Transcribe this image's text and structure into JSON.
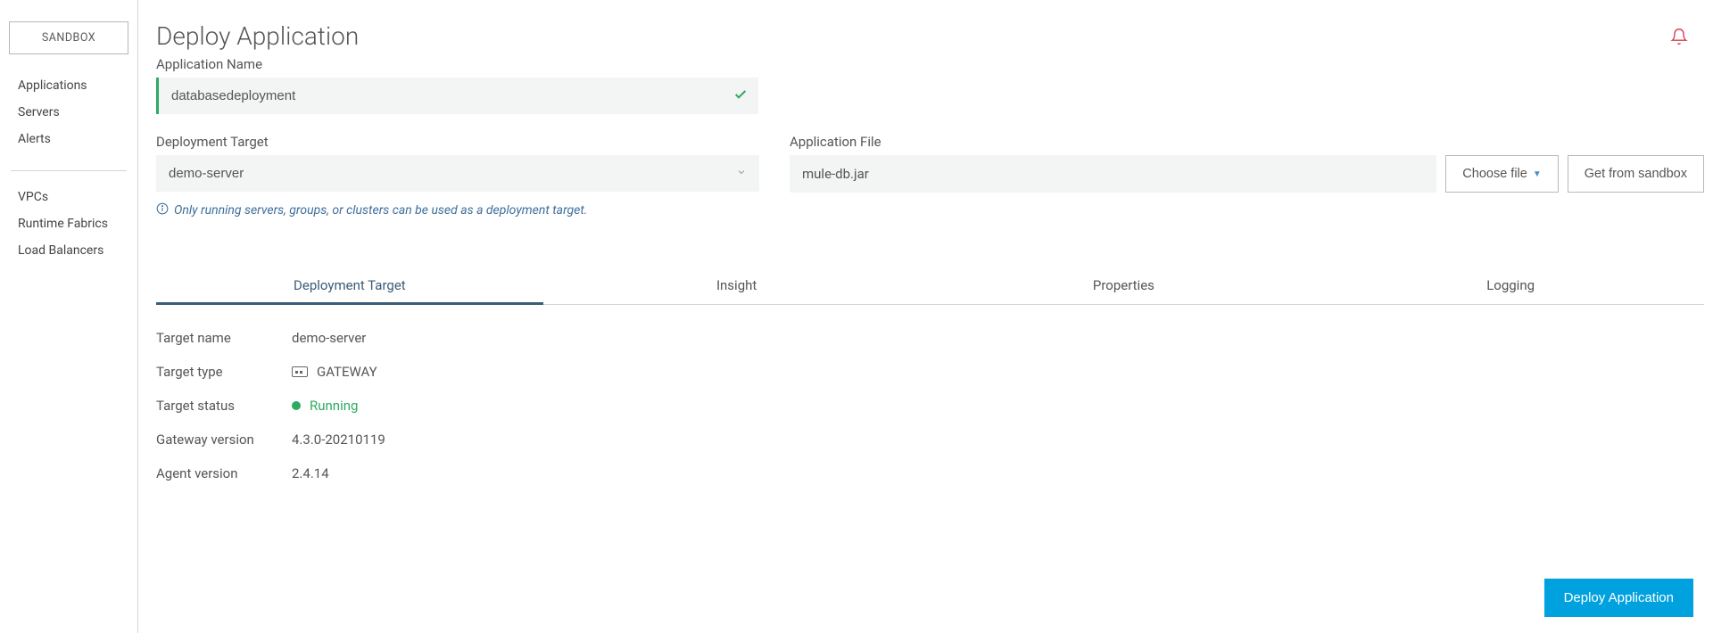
{
  "env": "SANDBOX",
  "nav": {
    "group1": [
      "Applications",
      "Servers",
      "Alerts"
    ],
    "group2": [
      "VPCs",
      "Runtime Fabrics",
      "Load Balancers"
    ]
  },
  "page_title": "Deploy Application",
  "app_name_label": "Application Name",
  "app_name_value": "databasedeployment",
  "target_label": "Deployment Target",
  "target_value": "demo-server",
  "target_note": "Only running servers, groups, or clusters can be used as a deployment target.",
  "file_label": "Application File",
  "file_value": "mule-db.jar",
  "choose_file": "Choose file",
  "get_sandbox": "Get from sandbox",
  "tabs": [
    "Deployment Target",
    "Insight",
    "Properties",
    "Logging"
  ],
  "details": {
    "target_name_k": "Target name",
    "target_name_v": "demo-server",
    "target_type_k": "Target type",
    "target_type_v": "GATEWAY",
    "target_status_k": "Target status",
    "target_status_v": "Running",
    "gateway_version_k": "Gateway version",
    "gateway_version_v": "4.3.0-20210119",
    "agent_version_k": "Agent version",
    "agent_version_v": "2.4.14"
  },
  "deploy_btn": "Deploy Application"
}
